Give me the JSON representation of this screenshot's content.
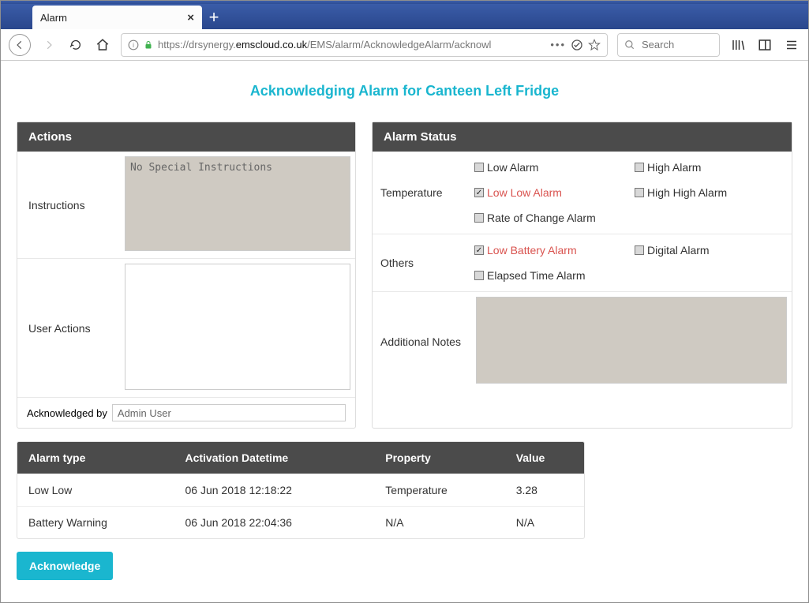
{
  "browser": {
    "tab_title": "Alarm",
    "url_pre": "https://drsynergy.",
    "url_domain": "emscloud.co.uk",
    "url_post": "/EMS/alarm/AcknowledgeAlarm/acknowl",
    "search_placeholder": "Search"
  },
  "page": {
    "title": "Acknowledging Alarm for Canteen Left Fridge"
  },
  "actions": {
    "heading": "Actions",
    "instructions_label": "Instructions",
    "instructions_text": "No Special Instructions",
    "user_actions_label": "User Actions",
    "ack_by_label": "Acknowledged by",
    "ack_by_value": "Admin User"
  },
  "status": {
    "heading": "Alarm Status",
    "temperature_label": "Temperature",
    "others_label": "Others",
    "notes_label": "Additional Notes",
    "checks": {
      "low_alarm": {
        "label": "Low Alarm",
        "checked": false,
        "active": false
      },
      "high_alarm": {
        "label": "High Alarm",
        "checked": false,
        "active": false
      },
      "low_low_alarm": {
        "label": "Low Low Alarm",
        "checked": true,
        "active": true
      },
      "high_high_alarm": {
        "label": "High High Alarm",
        "checked": false,
        "active": false
      },
      "rate_of_change": {
        "label": "Rate of Change Alarm",
        "checked": false,
        "active": false
      },
      "low_battery": {
        "label": "Low Battery Alarm",
        "checked": true,
        "active": true
      },
      "digital": {
        "label": "Digital Alarm",
        "checked": false,
        "active": false
      },
      "elapsed_time": {
        "label": "Elapsed Time Alarm",
        "checked": false,
        "active": false
      }
    }
  },
  "table": {
    "headers": {
      "type": "Alarm type",
      "dt": "Activation Datetime",
      "prop": "Property",
      "val": "Value"
    },
    "rows": [
      {
        "type": "Low Low",
        "dt": "06 Jun 2018 12:18:22",
        "prop": "Temperature",
        "val": "3.28"
      },
      {
        "type": "Battery Warning",
        "dt": "06 Jun 2018 22:04:36",
        "prop": "N/A",
        "val": "N/A"
      }
    ]
  },
  "acknowledge_btn": "Acknowledge"
}
